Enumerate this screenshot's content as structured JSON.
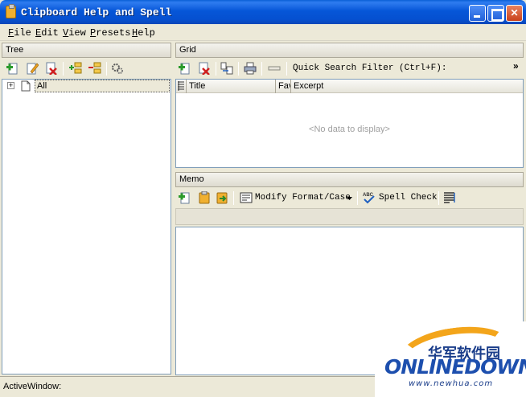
{
  "window": {
    "title": "Clipboard Help and Spell"
  },
  "menu": {
    "items": [
      "File",
      "Edit",
      "View",
      "Presets",
      "Help"
    ]
  },
  "tree": {
    "header": "Tree",
    "root_label": "All",
    "expander": "+",
    "toolbar_icons": [
      "add-icon",
      "edit-icon",
      "delete-icon",
      "add-child-icon",
      "remove-child-icon",
      "gear-icon"
    ]
  },
  "grid": {
    "header": "Grid",
    "search_label": "Quick Search Filter (Ctrl+F):",
    "overflow": "»",
    "columns": [
      "Title",
      "Fav",
      "Excerpt"
    ],
    "empty_text": "<No data to display>",
    "toolbar_icons": [
      "add-icon",
      "delete-icon",
      "export-icon",
      "print-icon",
      "clear-filter-icon"
    ]
  },
  "memo": {
    "header": "Memo",
    "modify_label": "Modify Format/Case",
    "spell_label": "Spell Check",
    "toolbar_icons": [
      "add-icon",
      "paste-icon",
      "copy-icon",
      "format-icon",
      "spellcheck-icon",
      "word-wrap-icon"
    ]
  },
  "status": {
    "text": "ActiveWindow:"
  },
  "watermark": {
    "cn": "华军软件园",
    "brand": "ONLINEDOWN",
    "url": "www.newhua.com"
  },
  "colors": {
    "title_blue": "#0656d8",
    "accent_orange": "#f3a51b",
    "panel_bg": "#ece9d8"
  }
}
